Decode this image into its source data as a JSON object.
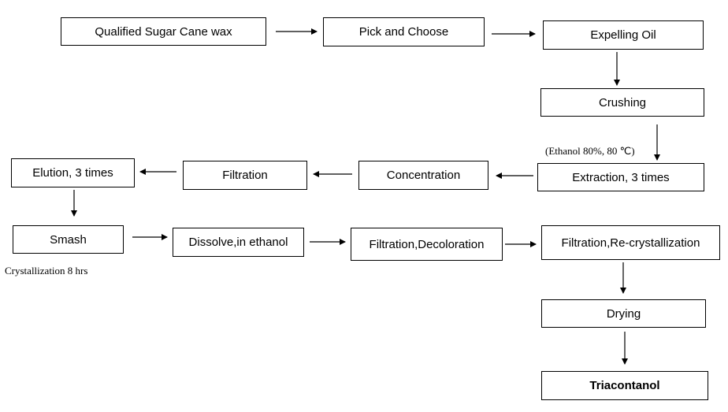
{
  "steps": {
    "s1": "Qualified Sugar Cane wax",
    "s2": "Pick and Choose",
    "s3": "Expelling Oil",
    "s4": "Crushing",
    "s5": "Extraction, 3 times",
    "s6": "Concentration",
    "s7": "Filtration",
    "s8": "Elution, 3 times",
    "s9": "Smash",
    "s10": "Dissolve,in ethanol",
    "s11": "Filtration,Decoloration",
    "s12": "Filtration,Re-crystallization",
    "s13": "Drying",
    "s14": "Triacontanol"
  },
  "notes": {
    "extraction_condition": "(Ethanol 80%, 80 ℃)",
    "crystallization": "Crystallization 8 hrs"
  }
}
